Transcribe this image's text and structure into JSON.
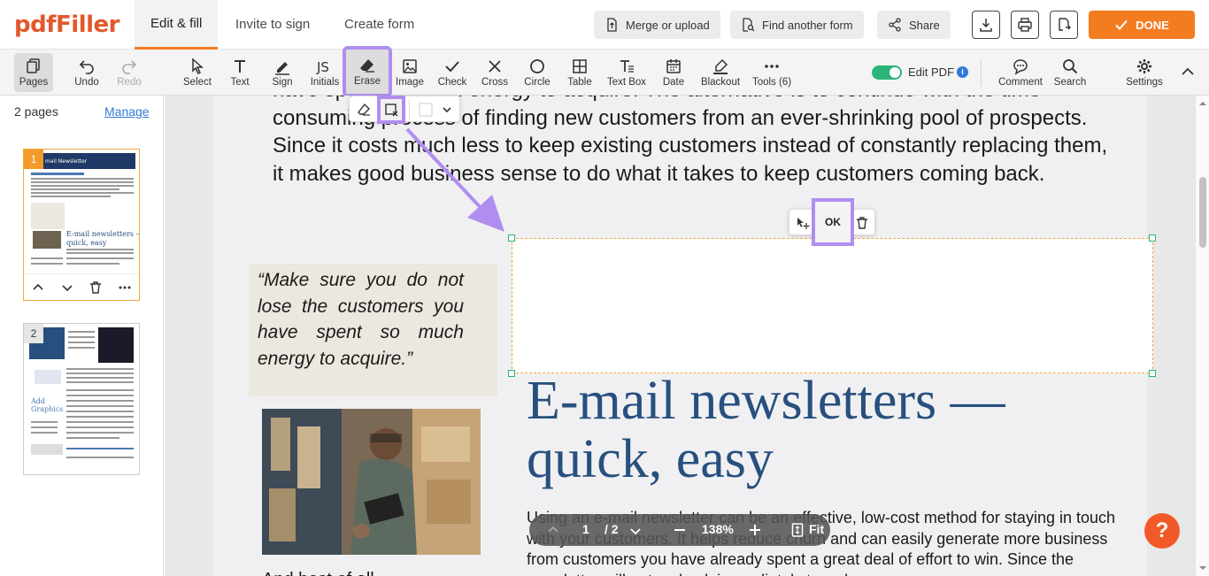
{
  "app": {
    "logo": "pdfFiller"
  },
  "tabs": [
    {
      "label": "Edit & fill"
    },
    {
      "label": "Invite to sign"
    },
    {
      "label": "Create form"
    }
  ],
  "header_buttons": {
    "merge": "Merge or upload",
    "find": "Find another form",
    "share": "Share",
    "done": "DONE"
  },
  "toolbar": {
    "pages": "Pages",
    "undo": "Undo",
    "redo": "Redo",
    "select": "Select",
    "text": "Text",
    "sign": "Sign",
    "initials": "Initials",
    "erase": "Erase",
    "image": "Image",
    "check": "Check",
    "cross": "Cross",
    "circle": "Circle",
    "table": "Table",
    "textbox": "Text Box",
    "date": "Date",
    "blackout": "Blackout",
    "tools": "Tools (6)",
    "edit_pdf": "Edit PDF",
    "comment": "Comment",
    "search": "Search",
    "settings": "Settings"
  },
  "sidebar": {
    "pages_count": "2 pages",
    "manage": "Manage",
    "thumb1_num": "1",
    "thumb2_num": "2"
  },
  "document": {
    "body_text": "have spent so much energy to acquire. The alternative is to continue with the time-consuming process of finding new customers from an ever-shrinking pool of prospects. Since it costs much less to keep existing customers instead of constantly replacing them, it makes good business sense to do what it takes to keep customers coming back.",
    "quote": "“Make sure you do not lose the customers you have spent so much energy to acquire.”",
    "heading": "E-mail newsletters — quick, easy",
    "paragraph": "Using an e-mail newsletter can be an effective, low-cost method for staying in touch with your customers. It helps reduce churn and can easily generate more business from customers you have already spent a great deal of effort to win. Since the newsletter will not go back immediately to web",
    "caption": "And best of all"
  },
  "popup": {
    "ok": "OK"
  },
  "zoom": {
    "page": "1",
    "total": "/ 2",
    "level": "138%",
    "fit": "Fit"
  },
  "help": "?",
  "colors": {
    "accent": "#f47c20",
    "highlight": "#b08ef0",
    "heading": "#27507e",
    "toggle_on": "#2cb57a"
  }
}
